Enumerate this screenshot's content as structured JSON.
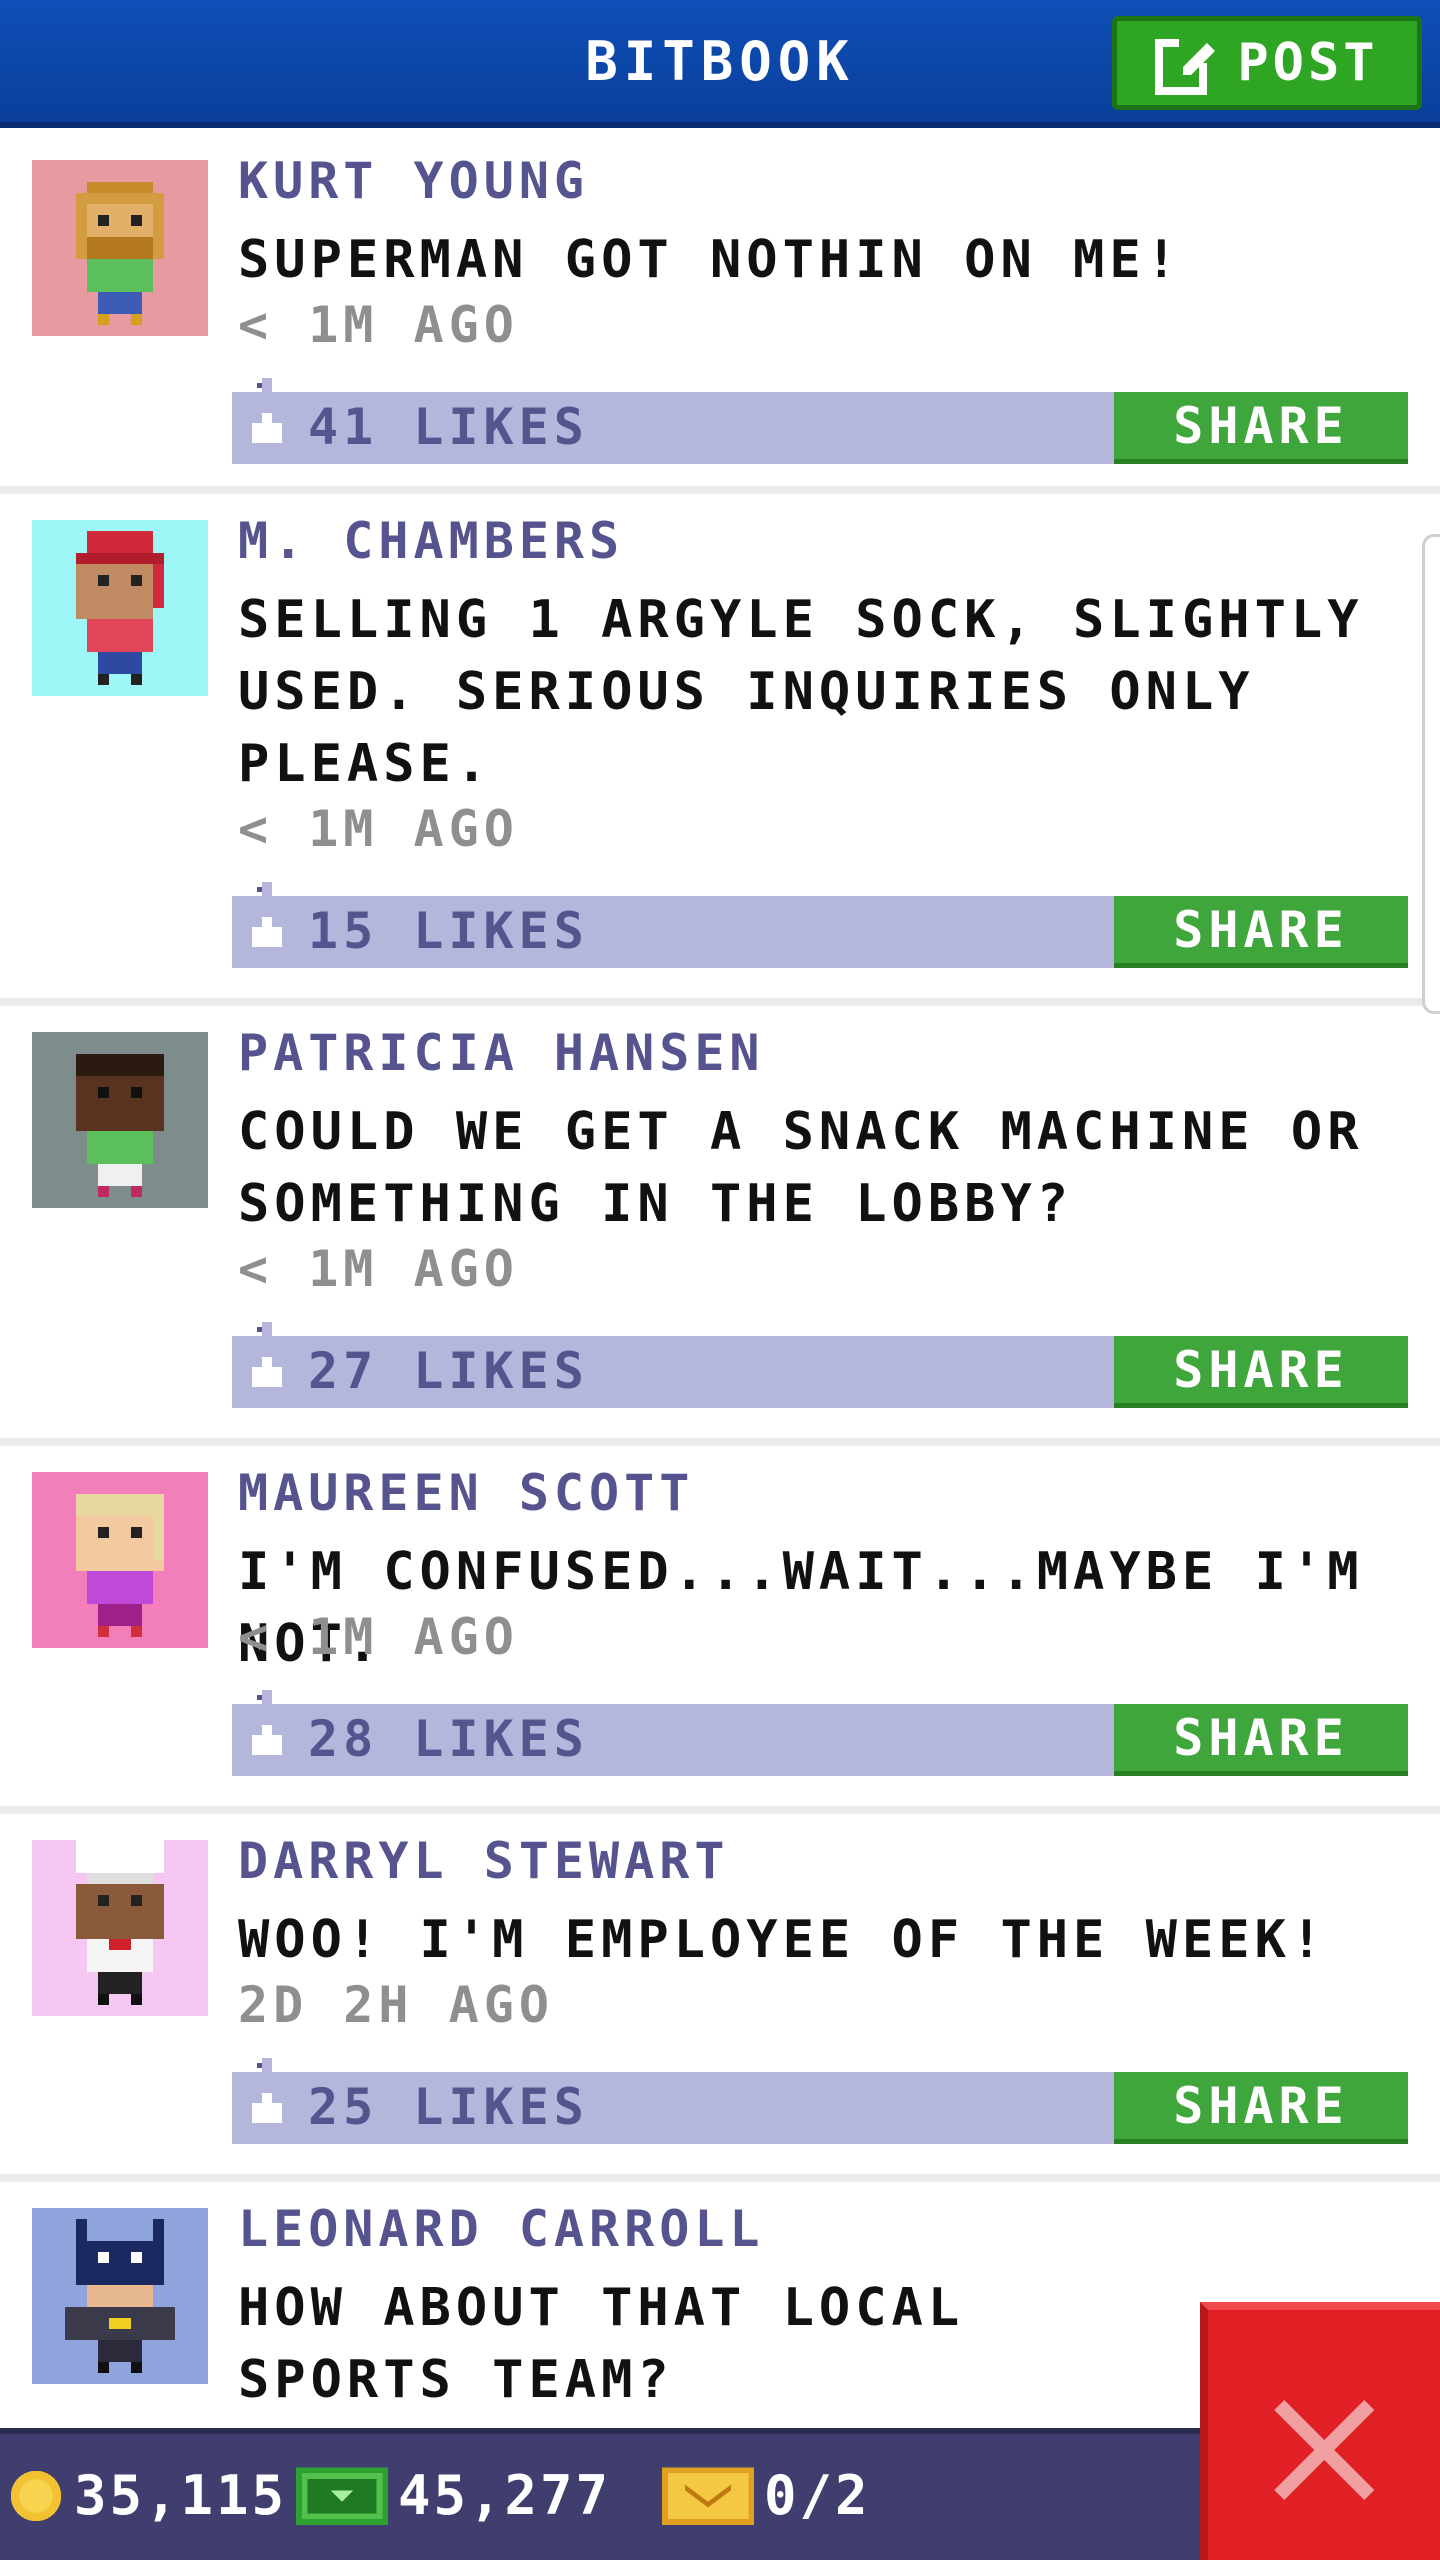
{
  "header": {
    "title": "BITBOOK",
    "post_label": "POST"
  },
  "posts": [
    {
      "name": "KURT YOUNG",
      "message": "SUPERMAN GOT NOTHIN ON ME!",
      "time": "< 1M AGO",
      "likes": "41 LIKES",
      "share": "SHARE",
      "avatar_bg": "#e79aa0"
    },
    {
      "name": "M. CHAMBERS",
      "message": "SELLING 1 ARGYLE SOCK, SLIGHTLY USED. SERIOUS INQUIRIES ONLY PLEASE.",
      "time": "< 1M AGO",
      "likes": "15 LIKES",
      "share": "SHARE",
      "avatar_bg": "#9ff6f6"
    },
    {
      "name": "PATRICIA HANSEN",
      "message": "COULD WE GET A SNACK MACHINE OR SOMETHING IN THE LOBBY?",
      "time": "< 1M AGO",
      "likes": "27 LIKES",
      "share": "SHARE",
      "avatar_bg": "#7f8c8c"
    },
    {
      "name": "MAUREEN SCOTT",
      "message": "I'M CONFUSED...WAIT...MAYBE I'M NOT.",
      "time": "< 1M AGO",
      "likes": "28 LIKES",
      "share": "SHARE",
      "avatar_bg": "#f27fb9"
    },
    {
      "name": "DARRYL STEWART",
      "message": "WOO! I'M EMPLOYEE OF THE WEEK!",
      "time": "2D 2H AGO",
      "likes": "25 LIKES",
      "share": "SHARE",
      "avatar_bg": "#f6c7f2"
    },
    {
      "name": "LEONARD CARROLL",
      "message": "HOW ABOUT THAT LOCAL SPORTS TEAM?",
      "time": "",
      "likes": "",
      "share": "",
      "avatar_bg": "#8fa3dc"
    }
  ],
  "footer": {
    "coins": "35,115",
    "bux": "45,277",
    "tickets": "0/2"
  },
  "colors": {
    "header": "#0f4fb8",
    "share": "#3ea63a",
    "likes_bar": "#b5b6dc",
    "name_text": "#56548f",
    "footer": "#3f3e6e",
    "close": "#e02025"
  },
  "icons": {
    "post": "edit-icon",
    "like": "thumb-up-icon",
    "coin": "coin-icon",
    "bux": "bux-icon",
    "ticket": "ticket-icon",
    "close": "close-icon"
  }
}
